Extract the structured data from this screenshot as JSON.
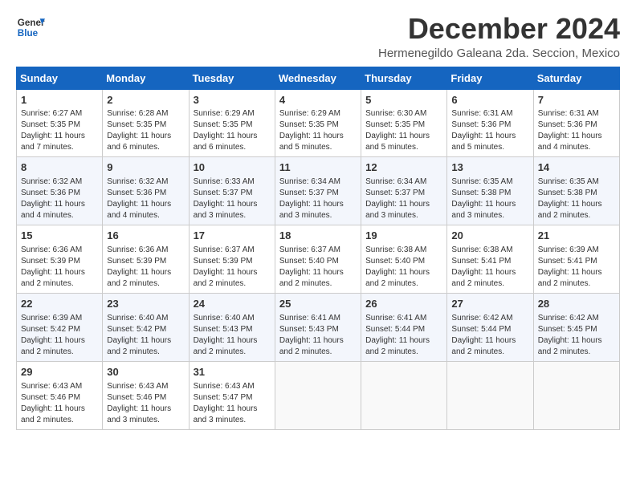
{
  "logo": {
    "line1": "General",
    "line2": "Blue"
  },
  "title": "December 2024",
  "location": "Hermenegildo Galeana 2da. Seccion, Mexico",
  "weekdays": [
    "Sunday",
    "Monday",
    "Tuesday",
    "Wednesday",
    "Thursday",
    "Friday",
    "Saturday"
  ],
  "weeks": [
    [
      {
        "day": 1,
        "sunrise": "6:27 AM",
        "sunset": "5:35 PM",
        "daylight": "11 hours and 7 minutes."
      },
      {
        "day": 2,
        "sunrise": "6:28 AM",
        "sunset": "5:35 PM",
        "daylight": "11 hours and 6 minutes."
      },
      {
        "day": 3,
        "sunrise": "6:29 AM",
        "sunset": "5:35 PM",
        "daylight": "11 hours and 6 minutes."
      },
      {
        "day": 4,
        "sunrise": "6:29 AM",
        "sunset": "5:35 PM",
        "daylight": "11 hours and 5 minutes."
      },
      {
        "day": 5,
        "sunrise": "6:30 AM",
        "sunset": "5:35 PM",
        "daylight": "11 hours and 5 minutes."
      },
      {
        "day": 6,
        "sunrise": "6:31 AM",
        "sunset": "5:36 PM",
        "daylight": "11 hours and 5 minutes."
      },
      {
        "day": 7,
        "sunrise": "6:31 AM",
        "sunset": "5:36 PM",
        "daylight": "11 hours and 4 minutes."
      }
    ],
    [
      {
        "day": 8,
        "sunrise": "6:32 AM",
        "sunset": "5:36 PM",
        "daylight": "11 hours and 4 minutes."
      },
      {
        "day": 9,
        "sunrise": "6:32 AM",
        "sunset": "5:36 PM",
        "daylight": "11 hours and 4 minutes."
      },
      {
        "day": 10,
        "sunrise": "6:33 AM",
        "sunset": "5:37 PM",
        "daylight": "11 hours and 3 minutes."
      },
      {
        "day": 11,
        "sunrise": "6:34 AM",
        "sunset": "5:37 PM",
        "daylight": "11 hours and 3 minutes."
      },
      {
        "day": 12,
        "sunrise": "6:34 AM",
        "sunset": "5:37 PM",
        "daylight": "11 hours and 3 minutes."
      },
      {
        "day": 13,
        "sunrise": "6:35 AM",
        "sunset": "5:38 PM",
        "daylight": "11 hours and 3 minutes."
      },
      {
        "day": 14,
        "sunrise": "6:35 AM",
        "sunset": "5:38 PM",
        "daylight": "11 hours and 2 minutes."
      }
    ],
    [
      {
        "day": 15,
        "sunrise": "6:36 AM",
        "sunset": "5:39 PM",
        "daylight": "11 hours and 2 minutes."
      },
      {
        "day": 16,
        "sunrise": "6:36 AM",
        "sunset": "5:39 PM",
        "daylight": "11 hours and 2 minutes."
      },
      {
        "day": 17,
        "sunrise": "6:37 AM",
        "sunset": "5:39 PM",
        "daylight": "11 hours and 2 minutes."
      },
      {
        "day": 18,
        "sunrise": "6:37 AM",
        "sunset": "5:40 PM",
        "daylight": "11 hours and 2 minutes."
      },
      {
        "day": 19,
        "sunrise": "6:38 AM",
        "sunset": "5:40 PM",
        "daylight": "11 hours and 2 minutes."
      },
      {
        "day": 20,
        "sunrise": "6:38 AM",
        "sunset": "5:41 PM",
        "daylight": "11 hours and 2 minutes."
      },
      {
        "day": 21,
        "sunrise": "6:39 AM",
        "sunset": "5:41 PM",
        "daylight": "11 hours and 2 minutes."
      }
    ],
    [
      {
        "day": 22,
        "sunrise": "6:39 AM",
        "sunset": "5:42 PM",
        "daylight": "11 hours and 2 minutes."
      },
      {
        "day": 23,
        "sunrise": "6:40 AM",
        "sunset": "5:42 PM",
        "daylight": "11 hours and 2 minutes."
      },
      {
        "day": 24,
        "sunrise": "6:40 AM",
        "sunset": "5:43 PM",
        "daylight": "11 hours and 2 minutes."
      },
      {
        "day": 25,
        "sunrise": "6:41 AM",
        "sunset": "5:43 PM",
        "daylight": "11 hours and 2 minutes."
      },
      {
        "day": 26,
        "sunrise": "6:41 AM",
        "sunset": "5:44 PM",
        "daylight": "11 hours and 2 minutes."
      },
      {
        "day": 27,
        "sunrise": "6:42 AM",
        "sunset": "5:44 PM",
        "daylight": "11 hours and 2 minutes."
      },
      {
        "day": 28,
        "sunrise": "6:42 AM",
        "sunset": "5:45 PM",
        "daylight": "11 hours and 2 minutes."
      }
    ],
    [
      {
        "day": 29,
        "sunrise": "6:43 AM",
        "sunset": "5:46 PM",
        "daylight": "11 hours and 2 minutes."
      },
      {
        "day": 30,
        "sunrise": "6:43 AM",
        "sunset": "5:46 PM",
        "daylight": "11 hours and 3 minutes."
      },
      {
        "day": 31,
        "sunrise": "6:43 AM",
        "sunset": "5:47 PM",
        "daylight": "11 hours and 3 minutes."
      },
      null,
      null,
      null,
      null
    ]
  ]
}
